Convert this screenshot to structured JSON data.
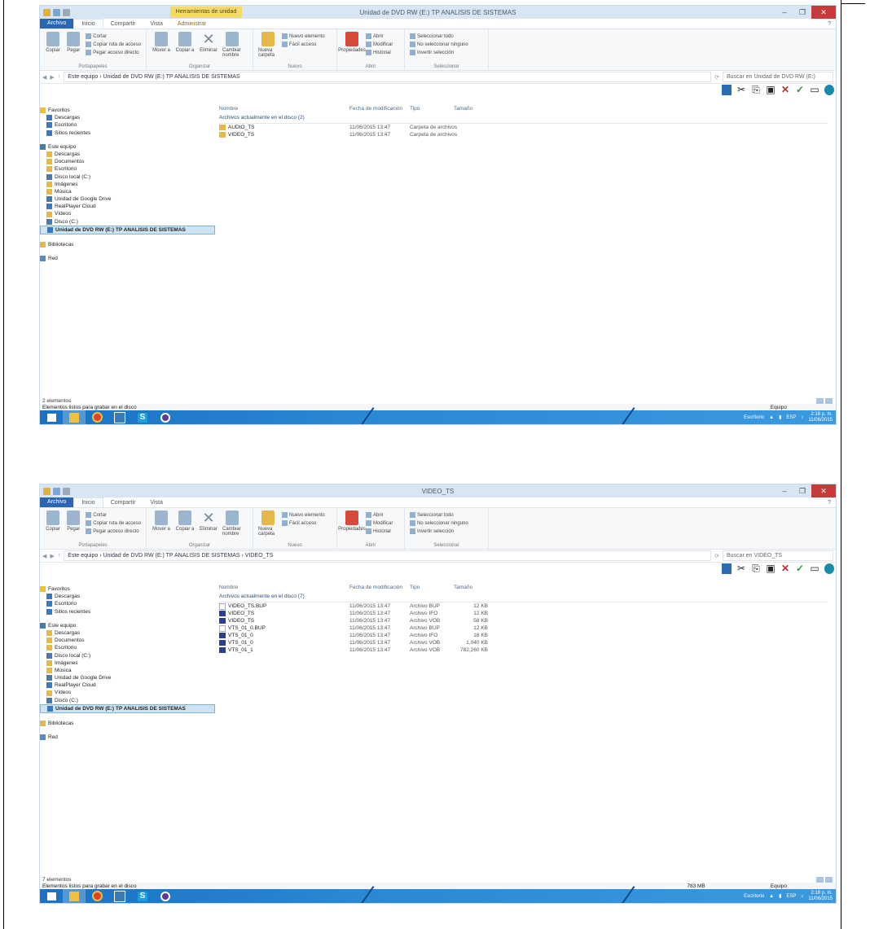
{
  "screens": [
    {
      "title": "Unidad de DVD RW (E:) TP ANALISIS DE SISTEMAS",
      "context_tab": "Herramientas de unidad",
      "address_path": "Este equipo › Unidad de DVD RW (E:) TP ANALISIS DE SISTEMAS",
      "search_placeholder": "Buscar en Unidad de DVD RW (E:)",
      "group_header": "Archivos actualmente en el disco (2)",
      "status_count": "2 elementos",
      "status_info": "Elementos listos para grabar en el disco",
      "status_size": "",
      "status_eq": "Equipo",
      "files": [
        {
          "name": "AUDIO_TS",
          "date": "11/06/2015 13:47",
          "type": "Carpeta de archivos",
          "size": "",
          "kind": "folder"
        },
        {
          "name": "VIDEO_TS",
          "date": "11/06/2015 13:47",
          "type": "Carpeta de archivos",
          "size": "",
          "kind": "folder"
        }
      ],
      "selected_nav": "Unidad de DVD RW (E:) TP ANALISIS DE SISTEMAS"
    },
    {
      "title": "VIDEO_TS",
      "context_tab": "",
      "address_path": "Este equipo › Unidad de DVD RW (E:) TP ANALISIS DE SISTEMAS › VIDEO_TS",
      "search_placeholder": "Buscar en VIDEO_TS",
      "group_header": "Archivos actualmente en el disco (7)",
      "status_count": "7 elementos",
      "status_info": "Elementos listos para grabar en el disco",
      "status_size": "783 MB",
      "status_eq": "Equipo",
      "files": [
        {
          "name": "VIDEO_TS.BUP",
          "date": "11/06/2015 13:47",
          "type": "Archivo BUP",
          "size": "12 KB",
          "kind": "bup"
        },
        {
          "name": "VIDEO_TS",
          "date": "11/06/2015 13:47",
          "type": "Archivo IFO",
          "size": "12 KB",
          "kind": "vob"
        },
        {
          "name": "VIDEO_TS",
          "date": "11/06/2015 13:47",
          "type": "Archivo VOB",
          "size": "58 KB",
          "kind": "vob"
        },
        {
          "name": "VTS_01_0.BUP",
          "date": "11/06/2015 13:47",
          "type": "Archivo BUP",
          "size": "12 KB",
          "kind": "bup"
        },
        {
          "name": "VTS_01_0",
          "date": "11/06/2015 13:47",
          "type": "Archivo IFO",
          "size": "18 KB",
          "kind": "vob"
        },
        {
          "name": "VTS_01_0",
          "date": "11/06/2015 13:47",
          "type": "Archivo VOB",
          "size": "1,040 KB",
          "kind": "vob"
        },
        {
          "name": "VTS_01_1",
          "date": "11/06/2015 13:47",
          "type": "Archivo VOB",
          "size": "782,260 KB",
          "kind": "vob"
        }
      ],
      "selected_nav": "Unidad de DVD RW (E:) TP ANALISIS DE SISTEMAS"
    }
  ],
  "tabs": {
    "file": "Archivo",
    "home": "Inicio",
    "share": "Compartir",
    "view": "Vista",
    "manage": "Administrar"
  },
  "ribbon": {
    "copy": "Copiar",
    "paste": "Pegar",
    "cut": "Cortar",
    "copy_path": "Copiar ruta de acceso",
    "paste_shortcut": "Pegar acceso directo",
    "clipboard": "Portapapeles",
    "move_to": "Mover a",
    "copy_to": "Copiar a",
    "delete": "Eliminar",
    "rename": "Cambiar nombre",
    "organize": "Organizar",
    "new_folder": "Nueva carpeta",
    "new_item": "Nuevo elemento",
    "easy_access": "Fácil acceso",
    "new": "Nuevo",
    "properties": "Propiedades",
    "open": "Abrir",
    "edit": "Modificar",
    "history": "Historial",
    "open_group": "Abrir",
    "select_all": "Seleccionar todo",
    "select_none": "No seleccionar ninguno",
    "invert": "Invertir selección",
    "select": "Seleccionar"
  },
  "columns": {
    "name": "Nombre",
    "date": "Fecha de modificación",
    "type": "Tipo",
    "size": "Tamaño"
  },
  "nav": {
    "favorites": "Favoritos",
    "downloads": "Descargas",
    "desktop": "Escritorio",
    "recent": "Sitios recientes",
    "this_pc": "Este equipo",
    "pc_downloads": "Descargas",
    "documents": "Documentos",
    "pc_desktop": "Escritorio",
    "local_disk": "Disco local (C:)",
    "images": "Imágenes",
    "music": "Música",
    "google_drive": "Unidad de Google Drive",
    "realplayer": "RealPlayer Cloud",
    "videos": "Vídeos",
    "net_c": "Disco (C:)",
    "libraries": "Bibliotecas",
    "network": "Red"
  },
  "tray": {
    "lang": "Escritorio",
    "keyboard": "ESP",
    "time": "2:18 p. m.",
    "date": "11/06/2015"
  }
}
